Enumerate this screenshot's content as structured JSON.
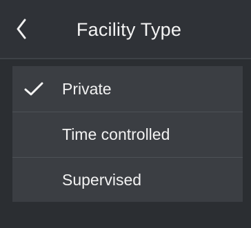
{
  "header": {
    "title": "Facility Type",
    "back_icon": "chevron-left-icon"
  },
  "options": [
    {
      "label": "Private",
      "selected": true,
      "icon": "checkmark-icon"
    },
    {
      "label": "Time controlled",
      "selected": false
    },
    {
      "label": "Supervised",
      "selected": false
    }
  ],
  "colors": {
    "background": "#2b2e32",
    "header": "#2f3237",
    "panel": "#3b3e43",
    "divider": "#4d5157",
    "text": "#f2f2f2"
  }
}
